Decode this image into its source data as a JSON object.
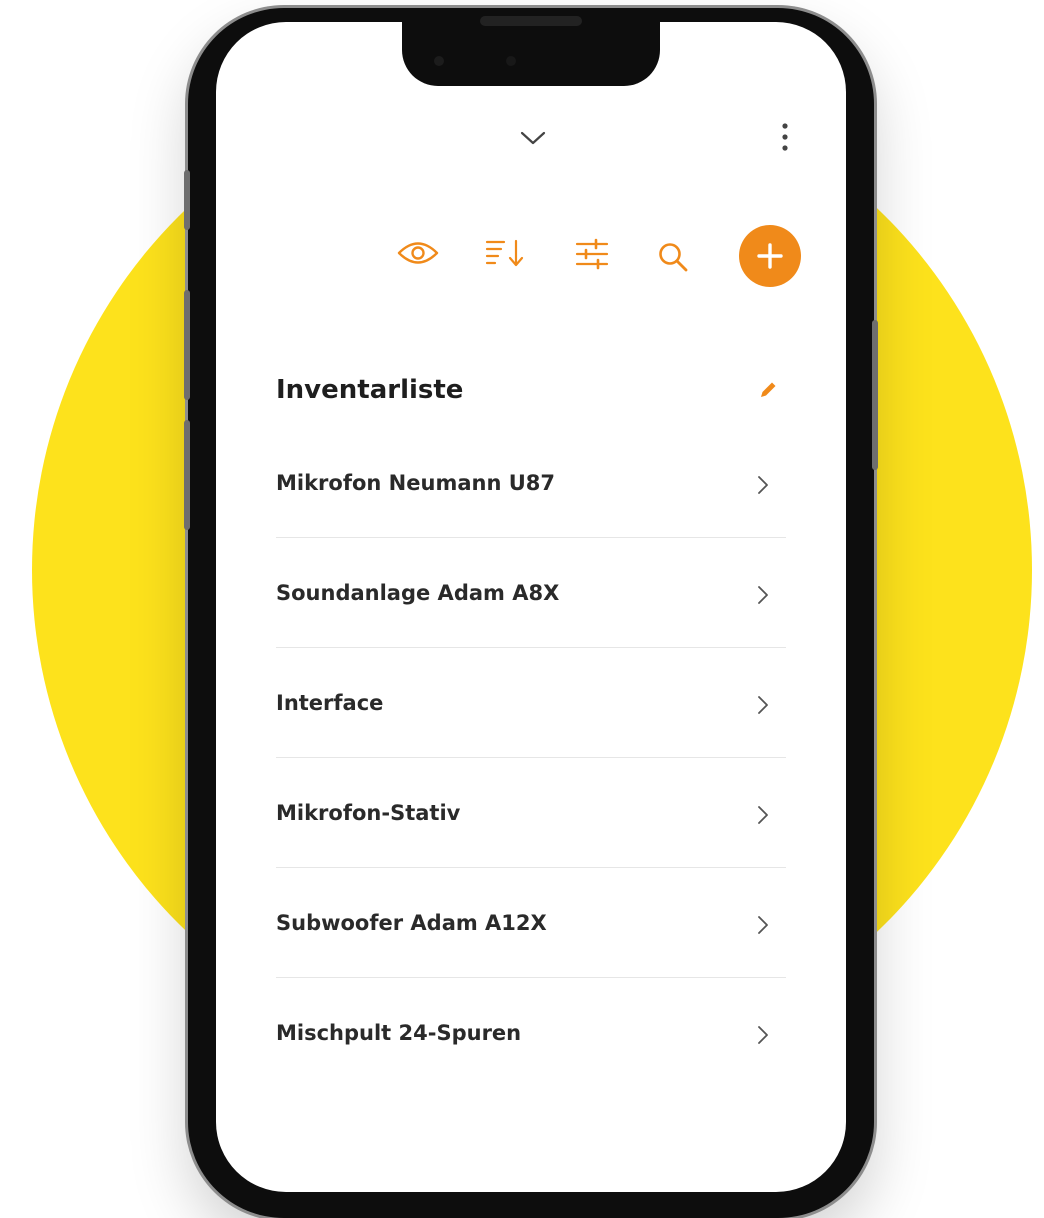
{
  "colors": {
    "accent": "#f08a1a",
    "background_circle": "#fde21c"
  },
  "header": {
    "collapse_icon": "chevron-down-icon",
    "more_icon": "more-vertical-icon"
  },
  "toolbar": {
    "icons": [
      "eye-icon",
      "sort-icon",
      "filter-icon",
      "search-icon",
      "add-icon"
    ]
  },
  "list": {
    "title": "Inventarliste",
    "edit_icon": "pencil-icon",
    "items": [
      {
        "label": "Mikrofon Neumann U87"
      },
      {
        "label": "Soundanlage Adam A8X"
      },
      {
        "label": "Interface"
      },
      {
        "label": "Mikrofon-Stativ"
      },
      {
        "label": "Subwoofer Adam A12X"
      },
      {
        "label": "Mischpult 24-Spuren"
      }
    ]
  }
}
